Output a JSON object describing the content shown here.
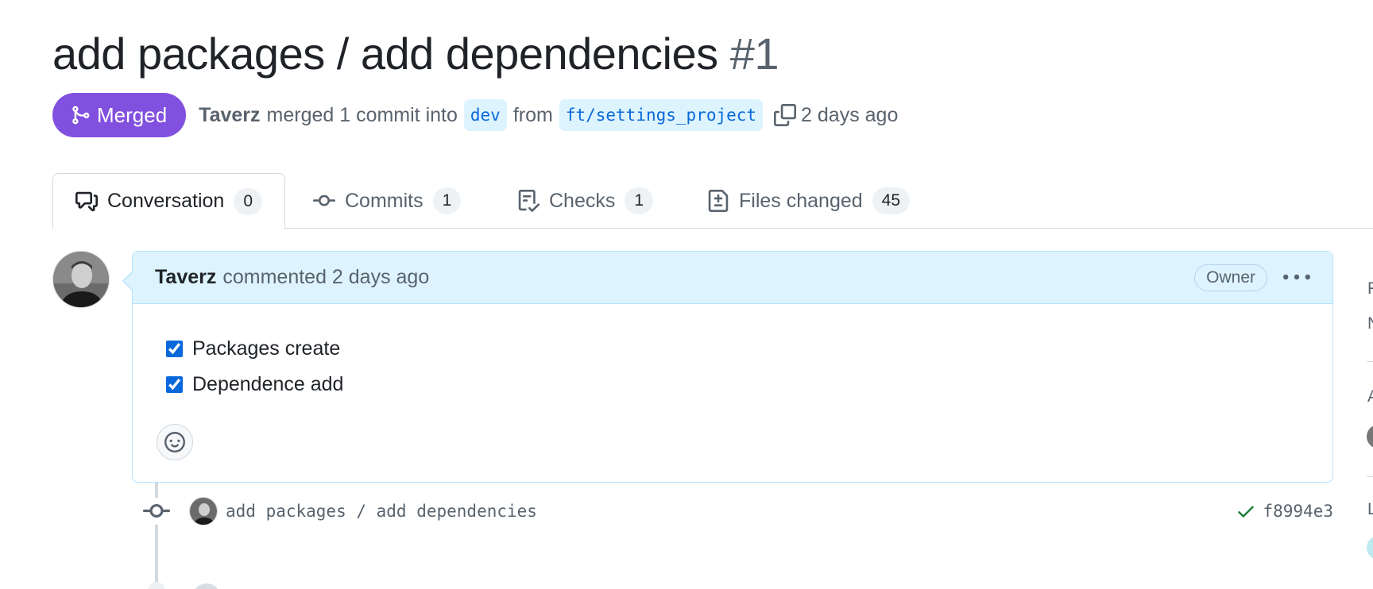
{
  "pr": {
    "title": "add packages / add dependencies",
    "number": "#1",
    "state": "Merged",
    "author": "Taverz",
    "action_text": "merged 1 commit into",
    "base_branch": "dev",
    "from_text": "from",
    "head_branch": "ft/settings_project",
    "time": "2 days ago"
  },
  "tabs": [
    {
      "label": "Conversation",
      "count": "0",
      "icon": "comment-discussion-icon",
      "selected": true
    },
    {
      "label": "Commits",
      "count": "1",
      "icon": "git-commit-icon",
      "selected": false
    },
    {
      "label": "Checks",
      "count": "1",
      "icon": "checklist-icon",
      "selected": false
    },
    {
      "label": "Files changed",
      "count": "45",
      "icon": "file-diff-icon",
      "selected": false
    }
  ],
  "comment": {
    "author": "Taverz",
    "meta": "commented 2 days ago",
    "badge": "Owner",
    "tasks": [
      {
        "label": "Packages create",
        "checked": true
      },
      {
        "label": "Dependence add",
        "checked": true
      }
    ]
  },
  "commit": {
    "message": "add packages / add dependencies",
    "sha": "f8994e3",
    "status": "success"
  },
  "sidebar_fragments": [
    "R",
    "N",
    "A",
    "L"
  ],
  "colors": {
    "merged": "#8250df",
    "link": "#0969da",
    "branch_bg": "#ddf4ff",
    "success": "#1a7f37"
  }
}
